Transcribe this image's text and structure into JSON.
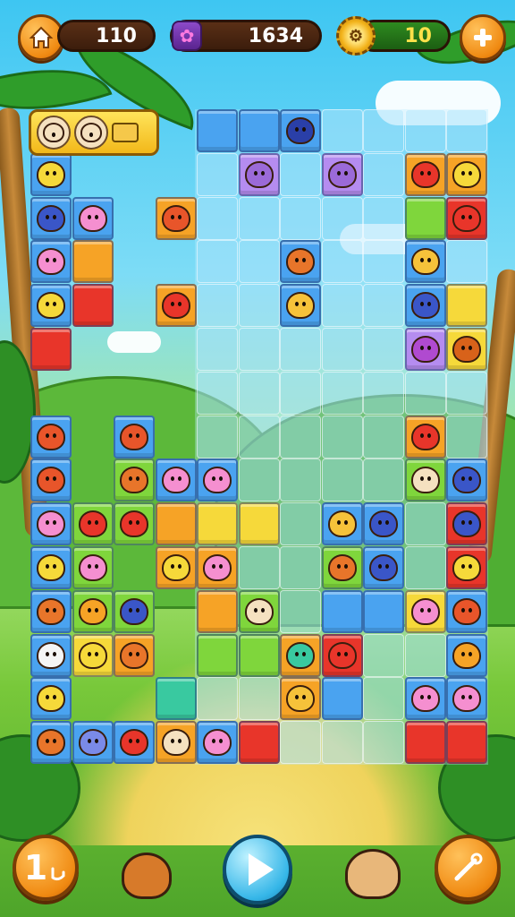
{
  "hud": {
    "home_icon": "home-icon",
    "moves": "110",
    "coins": "1634",
    "gem_icon": "flower-gem-icon",
    "gears": "10",
    "gear_icon": "gear-icon",
    "add_icon": "plus-icon"
  },
  "tray": {
    "slots": [
      "creature-face",
      "creature-face"
    ],
    "chest_icon": "chest-icon"
  },
  "bottom": {
    "undo_label": "1",
    "undo_icon": "undo-hand-icon",
    "play_icon": "play-icon",
    "hint_icon": "wand-icon",
    "pet_left": "squirrel-pet",
    "pet_right": "hamster-pet"
  },
  "colors": {
    "blue": "#4aa3f0",
    "orange": "#f6a326",
    "yellow": "#f6d93a",
    "red": "#e8352a",
    "green": "#7fd63c",
    "teal": "#39c9a0",
    "purple": "#b58cf0",
    "pink": "#f58fd0"
  }
}
